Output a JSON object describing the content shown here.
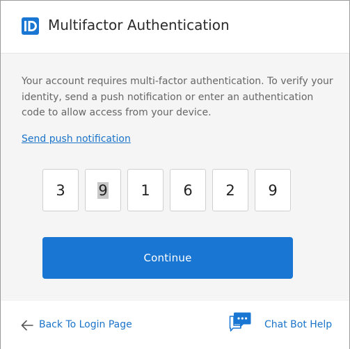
{
  "colors": {
    "brand": "#1976d2",
    "link": "#1a73c9"
  },
  "header": {
    "logo_icon": "id-badge-icon",
    "title": "Multifactor Authentication"
  },
  "main": {
    "description": "Your account requires multi-factor authentication. To verify your identity, send a push notification or enter an authentication code to allow access from your device.",
    "push_link_label": "Send push notification",
    "code_digits": [
      "3",
      "9",
      "1",
      "6",
      "2",
      "9"
    ],
    "continue_label": "Continue"
  },
  "footer": {
    "back_icon": "arrow-left-icon",
    "back_label": "Back To Login Page",
    "chat_icon": "chat-bubble-icon",
    "chat_label": "Chat Bot Help"
  }
}
